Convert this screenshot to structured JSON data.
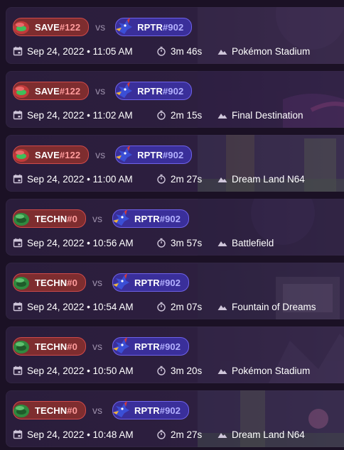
{
  "vs_label": "vs",
  "matches": [
    {
      "p1": {
        "name": "SAVE",
        "tag": "#122",
        "color": "red",
        "char": "samus-icon"
      },
      "p2": {
        "name": "RPTR",
        "tag": "#902",
        "color": "blue",
        "char": "falco-icon"
      },
      "date": "Sep 24, 2022 • 11:05 AM",
      "duration": "3m 46s",
      "stage": "Pokémon Stadium"
    },
    {
      "p1": {
        "name": "SAVE",
        "tag": "#122",
        "color": "red",
        "char": "samus-icon"
      },
      "p2": {
        "name": "RPTR",
        "tag": "#902",
        "color": "blue",
        "char": "falco-icon"
      },
      "date": "Sep 24, 2022 • 11:02 AM",
      "duration": "2m 15s",
      "stage": "Final Destination"
    },
    {
      "p1": {
        "name": "SAVE",
        "tag": "#122",
        "color": "red",
        "char": "samus-icon"
      },
      "p2": {
        "name": "RPTR",
        "tag": "#902",
        "color": "blue",
        "char": "falco-icon"
      },
      "date": "Sep 24, 2022 • 11:00 AM",
      "duration": "2m 27s",
      "stage": "Dream Land N64"
    },
    {
      "p1": {
        "name": "TECHN",
        "tag": "#0",
        "color": "red",
        "char": "samus-green-icon"
      },
      "p2": {
        "name": "RPTR",
        "tag": "#902",
        "color": "blue",
        "char": "falco-icon"
      },
      "date": "Sep 24, 2022 • 10:56 AM",
      "duration": "3m 57s",
      "stage": "Battlefield"
    },
    {
      "p1": {
        "name": "TECHN",
        "tag": "#0",
        "color": "red",
        "char": "samus-green-icon"
      },
      "p2": {
        "name": "RPTR",
        "tag": "#902",
        "color": "blue",
        "char": "falco-icon"
      },
      "date": "Sep 24, 2022 • 10:54 AM",
      "duration": "2m 07s",
      "stage": "Fountain of Dreams"
    },
    {
      "p1": {
        "name": "TECHN",
        "tag": "#0",
        "color": "red",
        "char": "samus-green-icon"
      },
      "p2": {
        "name": "RPTR",
        "tag": "#902",
        "color": "blue",
        "char": "falco-icon"
      },
      "date": "Sep 24, 2022 • 10:50 AM",
      "duration": "3m 20s",
      "stage": "Pokémon Stadium"
    },
    {
      "p1": {
        "name": "TECHN",
        "tag": "#0",
        "color": "red",
        "char": "samus-green-icon"
      },
      "p2": {
        "name": "RPTR",
        "tag": "#902",
        "color": "blue",
        "char": "falco-icon"
      },
      "date": "Sep 24, 2022 • 10:48 AM",
      "duration": "2m 27s",
      "stage": "Dream Land N64"
    }
  ]
}
